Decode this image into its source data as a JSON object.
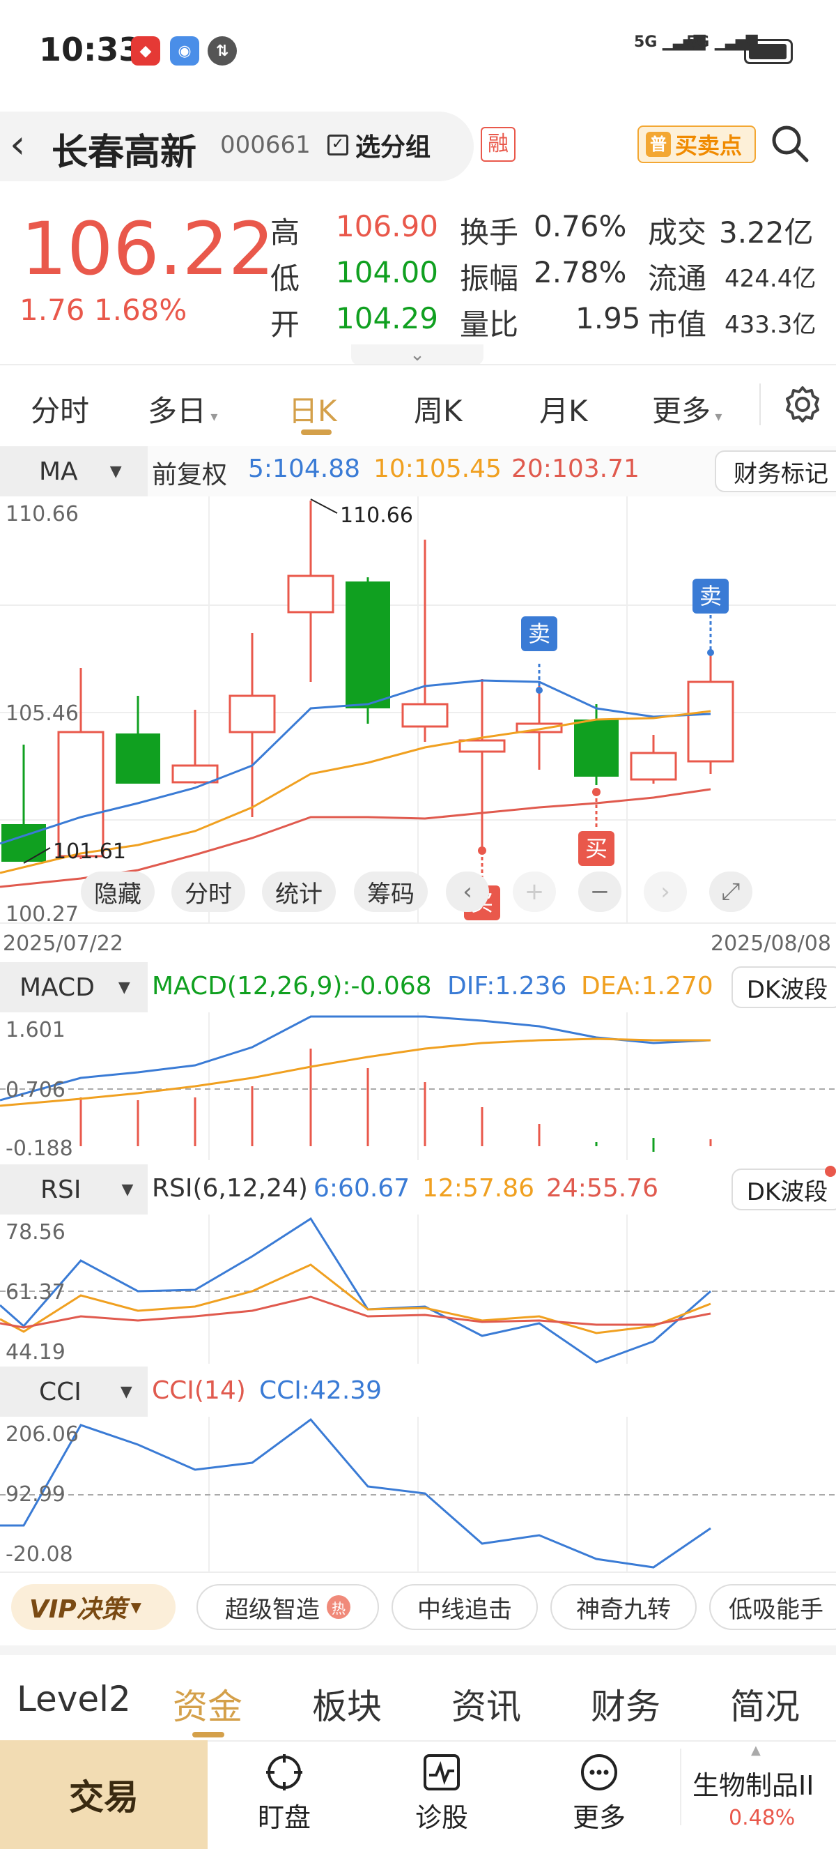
{
  "status": {
    "time": "10:33",
    "net1": "5G",
    "net2": "5G"
  },
  "stock": {
    "name": "长春高新",
    "code": "000661",
    "group": "选分组",
    "margin": "融",
    "buysell": "买卖点",
    "price": "106.22",
    "change": "1.76",
    "change_pct": "1.68%",
    "q_labels": [
      "高",
      "低",
      "开"
    ],
    "q_values": [
      "106.90",
      "104.00",
      "104.29"
    ],
    "q2_labels": [
      "换手",
      "振幅",
      "量比"
    ],
    "q2_values": [
      "0.76%",
      "2.78%",
      "1.95"
    ],
    "q3_labels": [
      "成交",
      "流通",
      "市值"
    ],
    "q3_values": [
      "3.22亿",
      "424.4亿",
      "433.3亿"
    ]
  },
  "tabs": [
    "分时",
    "多日",
    "日K",
    "周K",
    "月K",
    "更多"
  ],
  "kline": {
    "ma_btn": "MA",
    "adj": "前复权",
    "ma5": "5:104.88",
    "ma10": "10:105.45",
    "ma20": "20:103.71",
    "fin_mark": "财务标记",
    "y_top": "110.66",
    "y_mid": "105.46",
    "y_bot": "100.27",
    "max_label": "110.66",
    "min_label": "101.61",
    "date_start": "2025/07/22",
    "date_end": "2025/08/08",
    "sell": "卖",
    "buy": "买",
    "tools": [
      "隐藏",
      "分时",
      "统计",
      "筹码"
    ]
  },
  "macd": {
    "btn": "MACD",
    "title": "MACD(12,26,9):-0.068",
    "dif": "DIF:1.236",
    "dea": "DEA:1.270",
    "dk": "DK波段",
    "y1": "1.601",
    "y2": "0.706",
    "y3": "-0.188"
  },
  "rsi": {
    "btn": "RSI",
    "title": "RSI(6,12,24)",
    "r6": "6:60.67",
    "r12": "12:57.86",
    "r24": "24:55.76",
    "dk": "DK波段",
    "y1": "78.56",
    "y2": "61.37",
    "y3": "44.19"
  },
  "cci": {
    "btn": "CCI",
    "title": "CCI(14)",
    "val": "CCI:42.39",
    "y1": "206.06",
    "y2": "92.99",
    "y3": "-20.08"
  },
  "strategy": {
    "vip": "VIP决策",
    "chips": [
      "超级智造",
      "中线追击",
      "神奇九转",
      "低吸能手"
    ]
  },
  "bottom_tabs": [
    "Level2",
    "资金",
    "板块",
    "资讯",
    "财务",
    "简况"
  ],
  "footer": {
    "trade": "交易",
    "items": [
      "盯盘",
      "诊股",
      "更多"
    ],
    "sector": "生物制品II",
    "sector_pct": "0.48%"
  },
  "colors": {
    "up": "#e9584b",
    "down": "#10a020",
    "gold": "#d4a04a",
    "ma5": "#3a7bd5",
    "ma10": "#f0a020",
    "ma20": "#e05a4e"
  }
}
